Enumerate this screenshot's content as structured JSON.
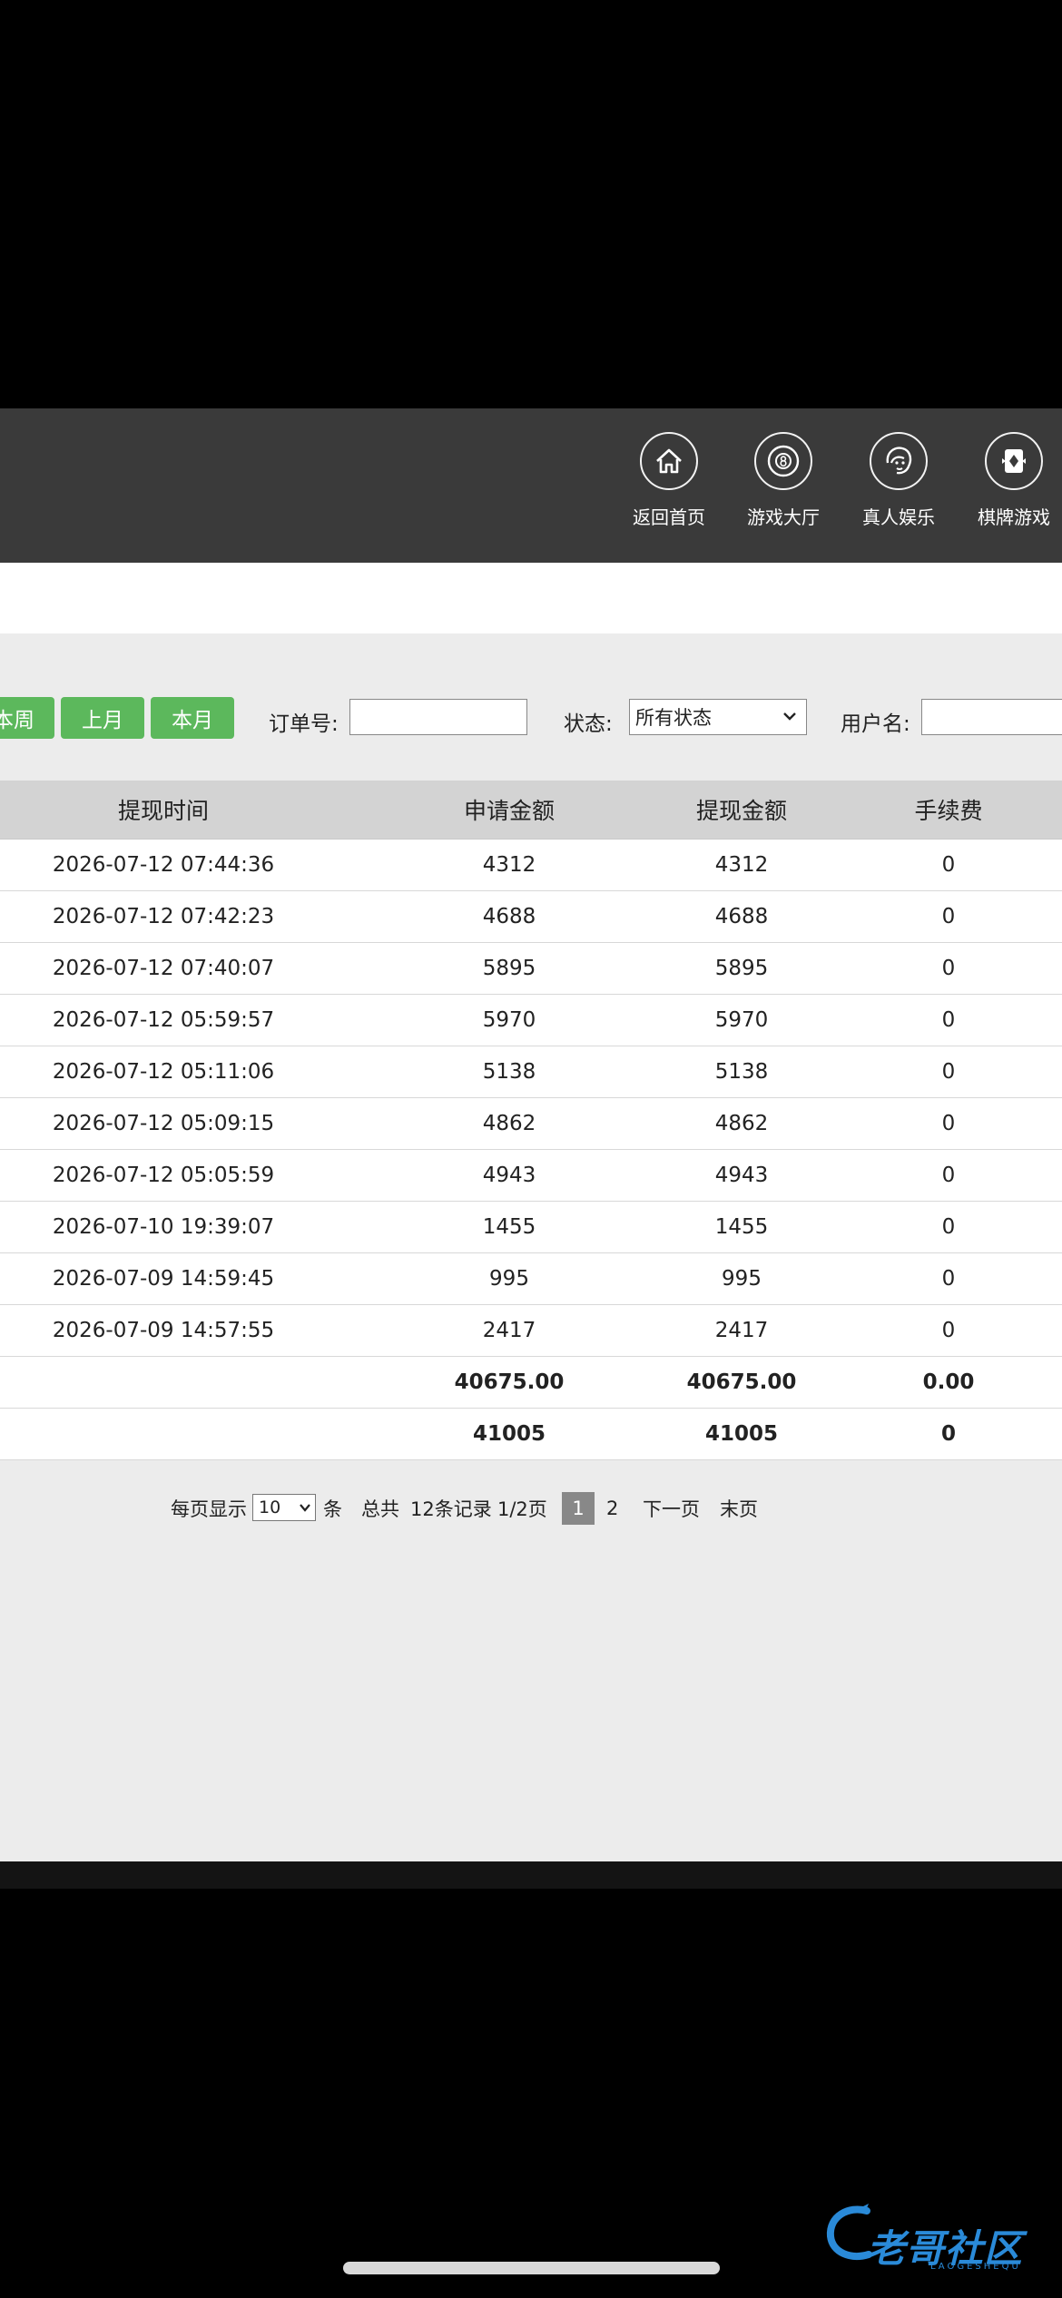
{
  "nav": {
    "items": [
      {
        "label": "返回首页",
        "icon": "home-icon"
      },
      {
        "label": "游戏大厅",
        "icon": "billiard-ball-icon"
      },
      {
        "label": "真人娱乐",
        "icon": "dealer-face-icon"
      },
      {
        "label": "棋牌游戏",
        "icon": "playing-card-icon"
      }
    ]
  },
  "filters": {
    "buttons": [
      "本周",
      "上月",
      "本月"
    ],
    "order_label": "订单号:",
    "order_value": "",
    "status_label": "状态:",
    "status_value": "所有状态",
    "user_label": "用户名:",
    "user_value": ""
  },
  "table": {
    "headers": [
      "提现时间",
      "申请金额",
      "提现金额",
      "手续费"
    ],
    "rows": [
      [
        "2026-07-12 07:44:36",
        "4312",
        "4312",
        "0"
      ],
      [
        "2026-07-12 07:42:23",
        "4688",
        "4688",
        "0"
      ],
      [
        "2026-07-12 07:40:07",
        "5895",
        "5895",
        "0"
      ],
      [
        "2026-07-12 05:59:57",
        "5970",
        "5970",
        "0"
      ],
      [
        "2026-07-12 05:11:06",
        "5138",
        "5138",
        "0"
      ],
      [
        "2026-07-12 05:09:15",
        "4862",
        "4862",
        "0"
      ],
      [
        "2026-07-12 05:05:59",
        "4943",
        "4943",
        "0"
      ],
      [
        "2026-07-10 19:39:07",
        "1455",
        "1455",
        "0"
      ],
      [
        "2026-07-09 14:59:45",
        "995",
        "995",
        "0"
      ],
      [
        "2026-07-09 14:57:55",
        "2417",
        "2417",
        "0"
      ]
    ],
    "subtotal": [
      "",
      "40675.00",
      "40675.00",
      "0.00"
    ],
    "total": [
      "",
      "41005",
      "41005",
      "0"
    ]
  },
  "pager": {
    "per_page_label": "每页显示",
    "per_page_value": "10",
    "unit": "条",
    "total_label": "总共",
    "records": "12条记录",
    "page_info": "1/2页",
    "pages": [
      "1",
      "2"
    ],
    "next": "下一页",
    "last": "末页"
  },
  "watermark": {
    "text": "老哥社区",
    "sub": "LAOGESHEQU"
  },
  "colors": {
    "navbar": "#3a3a3a",
    "accent_green": "#5cb85c",
    "header_bg": "#d3d3d3",
    "page_bg": "#ececec",
    "watermark": "#2a8ad8"
  }
}
